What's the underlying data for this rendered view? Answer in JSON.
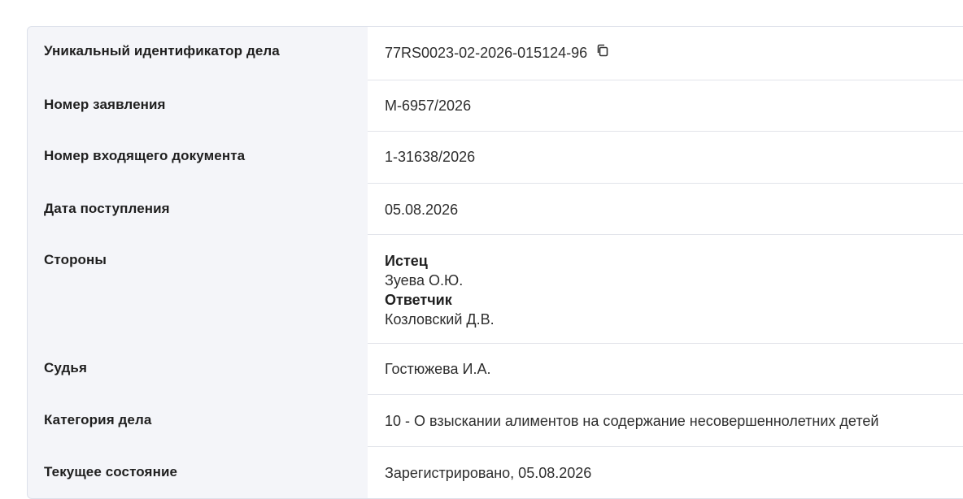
{
  "case": {
    "uid": {
      "label": "Уникальный идентификатор дела",
      "value": "77RS0023-02-2026-015124-96"
    },
    "application_number": {
      "label": "Номер заявления",
      "value": "М-6957/2026"
    },
    "incoming_doc_number": {
      "label": "Номер входящего документа",
      "value": "1-31638/2026"
    },
    "receipt_date": {
      "label": "Дата поступления",
      "value": "05.08.2026"
    },
    "parties": {
      "label": "Стороны",
      "plaintiff_role": "Истец",
      "plaintiff_name": "Зуева О.Ю.",
      "defendant_role": "Ответчик",
      "defendant_name": "Козловский Д.В."
    },
    "judge": {
      "label": "Судья",
      "value": "Гостюжева И.А."
    },
    "category": {
      "label": "Категория дела",
      "value": "10 - О взыскании алиментов на содержание несовершеннолетних детей"
    },
    "status": {
      "label": "Текущее состояние",
      "value": "Зарегистрировано, 05.08.2026"
    }
  },
  "icons": {
    "copy": "copy-icon"
  }
}
